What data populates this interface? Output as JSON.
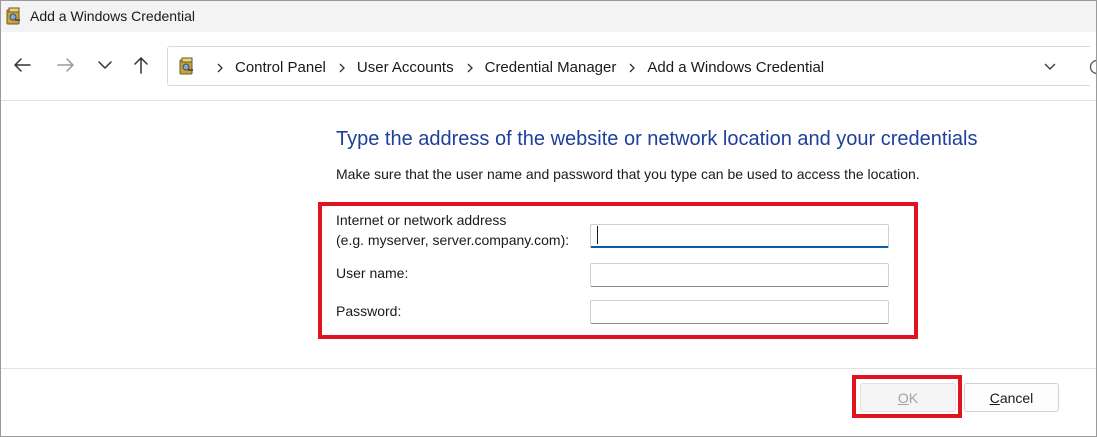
{
  "window": {
    "title": "Add a Windows Credential",
    "icon": "credential-manager-icon"
  },
  "nav": {
    "back_icon": "arrow-left-icon",
    "forward_icon": "arrow-right-icon",
    "recent_icon": "chevron-down-icon",
    "up_icon": "arrow-up-icon"
  },
  "address": {
    "crumbs": [
      "Control Panel",
      "User Accounts",
      "Credential Manager",
      "Add a Windows Credential"
    ],
    "separator_icon": "chevron-right-icon",
    "dropdown_icon": "chevron-down-icon",
    "refresh_icon": "refresh-icon"
  },
  "content": {
    "heading": "Type the address of the website or network location and your credentials",
    "description": "Make sure that the user name and password that you type can be used to access the location."
  },
  "form": {
    "address_label_line1": "Internet or network address",
    "address_label_line2": "(e.g. myserver, server.company.com):",
    "address_value": "",
    "username_label": "User name:",
    "username_value": "",
    "password_label": "Password:",
    "password_value": ""
  },
  "buttons": {
    "ok_label": "OK",
    "ok_access_key": "O",
    "ok_rest": "K",
    "cancel_label": "Cancel",
    "cancel_access_key": "C",
    "cancel_rest": "ancel"
  },
  "colors": {
    "heading": "#1e3f9a",
    "highlight": "#e0141e",
    "focus": "#0b5cad"
  }
}
